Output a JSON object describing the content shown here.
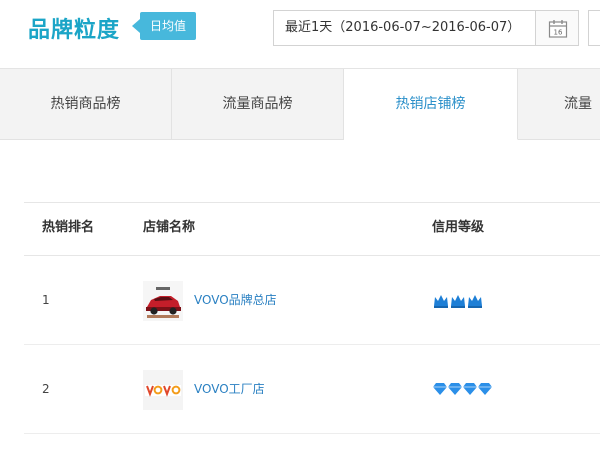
{
  "header": {
    "title": "品牌粒度",
    "badge": "日均值",
    "date_range": "最近1天（2016-06-07~2016-06-07）",
    "calendar_icon": "calendar-icon",
    "calendar_day": "16"
  },
  "tabs": [
    {
      "label": "热销商品榜",
      "active": false
    },
    {
      "label": "流量商品榜",
      "active": false
    },
    {
      "label": "热销店铺榜",
      "active": true
    },
    {
      "label": "流量",
      "active": false
    }
  ],
  "table": {
    "headers": {
      "rank": "热销排名",
      "shop": "店铺名称",
      "credit": "信用等级"
    },
    "rows": [
      {
        "rank": "1",
        "shop": "VOVO品牌总店",
        "logo": "vovo-car-logo",
        "credit_icon": "crown-icon",
        "credit_count": 3
      },
      {
        "rank": "2",
        "shop": "VOVO工厂店",
        "logo": "vovo-text-logo",
        "credit_icon": "diamond-icon",
        "credit_count": 4
      }
    ]
  },
  "colors": {
    "accent": "#1ba5c7",
    "badge_bg": "#47b8dc",
    "link": "#2a80c2",
    "crown": "#1e7fd6",
    "diamond": "#2b8fe8"
  }
}
